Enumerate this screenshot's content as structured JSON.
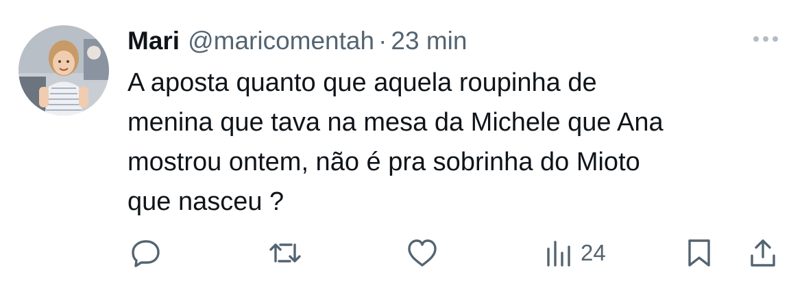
{
  "tweet": {
    "author": {
      "display_name": "Mari",
      "handle": "@maricomentah",
      "separator": "·",
      "timestamp": "23 min"
    },
    "text": "A aposta quanto que aquela roupinha de\nmenina que tava na mesa da Michele que Ana\nmostrou ontem, não é pra sobrinha do Mioto\nque nasceu ?",
    "actions": {
      "reply_icon": "reply-icon",
      "retweet_icon": "retweet-icon",
      "like_icon": "heart-icon",
      "views_icon": "views-chart-icon",
      "views_count": "24",
      "bookmark_icon": "bookmark-icon",
      "share_icon": "share-icon"
    }
  },
  "colors": {
    "text_primary": "#0f1419",
    "text_secondary": "#536471",
    "icon": "#536471"
  }
}
